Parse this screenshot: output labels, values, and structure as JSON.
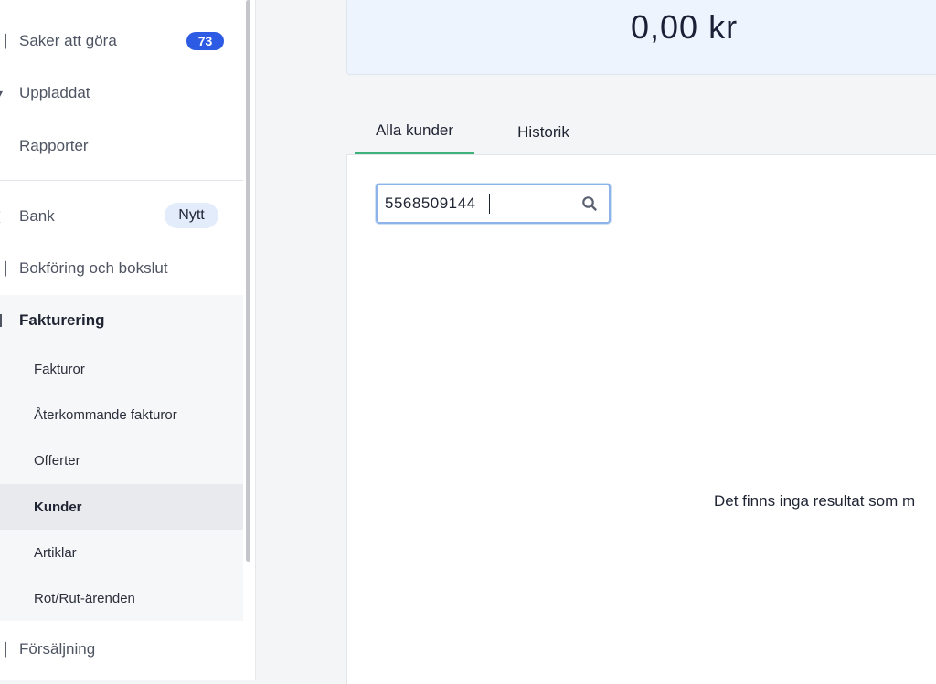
{
  "sidebar": {
    "items": [
      {
        "label": "Saker att göra",
        "badge": "73"
      },
      {
        "label": "Uppladdat"
      },
      {
        "label": "Rapporter"
      },
      {
        "label": "Bank",
        "badge": "Nytt"
      },
      {
        "label": "Bokföring och bokslut"
      }
    ],
    "section": {
      "label": "Fakturering",
      "items": [
        {
          "label": "Fakturor"
        },
        {
          "label": "Återkommande fakturor"
        },
        {
          "label": "Offerter"
        },
        {
          "label": "Kunder",
          "active": true
        },
        {
          "label": "Artiklar"
        },
        {
          "label": "Rot/Rut-ärenden"
        }
      ]
    },
    "after": [
      {
        "label": "Försäljning"
      }
    ]
  },
  "summary": {
    "value": "0,00 kr"
  },
  "tabs": [
    {
      "label": "Alla kunder",
      "active": true
    },
    {
      "label": "Historik"
    }
  ],
  "search": {
    "value": "5568509144"
  },
  "empty_message": "Det finns inga resultat som m",
  "colors": {
    "accent": "#2d5be3",
    "tab_active": "#3db37a"
  }
}
